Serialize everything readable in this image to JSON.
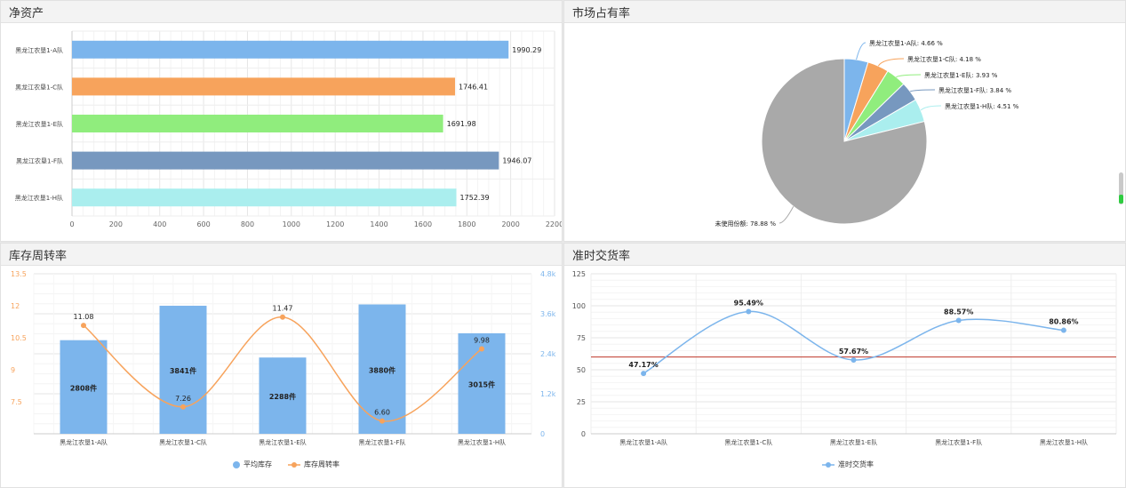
{
  "panels": {
    "net_assets": "净资产",
    "market_share": "市场占有率",
    "inventory_turnover": "库存周转率",
    "on_time_delivery": "准时交货率"
  },
  "chart_data": [
    {
      "type": "bar",
      "title": "净资产",
      "orientation": "horizontal",
      "categories": [
        "黑龙江农垦1-A队",
        "黑龙江农垦1-C队",
        "黑龙江农垦1-E队",
        "黑龙江农垦1-F队",
        "黑龙江农垦1-H队"
      ],
      "values": [
        1990.29,
        1746.41,
        1691.98,
        1946.07,
        1752.39
      ],
      "value_labels": [
        "1990.29",
        "1746.41",
        "1691.98",
        "1946.07",
        "1752.39"
      ],
      "colors": [
        "#7cb5ec",
        "#f7a35c",
        "#90ed7d",
        "#7798bf",
        "#aaeeee"
      ],
      "xlim": [
        0,
        2200
      ],
      "xticks": [
        0,
        200,
        400,
        600,
        800,
        1000,
        1200,
        1400,
        1600,
        1800,
        2000,
        2200
      ],
      "grid": true
    },
    {
      "type": "pie",
      "title": "市场占有率",
      "labels": [
        "黑龙江农垦1-A队",
        "黑龙江农垦1-C队",
        "黑龙江农垦1-E队",
        "黑龙江农垦1-F队",
        "黑龙江农垦1-H队",
        "未使用份额"
      ],
      "values": [
        4.66,
        4.18,
        3.93,
        3.84,
        4.51,
        78.88
      ],
      "label_texts": [
        "黑龙江农垦1-A队: 4.66 %",
        "黑龙江农垦1-C队: 4.18 %",
        "黑龙江农垦1-E队: 3.93 %",
        "黑龙江农垦1-F队: 3.84 %",
        "黑龙江农垦1-H队: 4.51 %",
        "未使用份额: 78.88 %"
      ],
      "colors": [
        "#7cb5ec",
        "#f7a35c",
        "#90ed7d",
        "#7798bf",
        "#aaeeee",
        "#a9a9a9"
      ]
    },
    {
      "type": "bar",
      "title": "库存周转率",
      "categories": [
        "黑龙江农垦1-A队",
        "黑龙江农垦1-C队",
        "黑龙江农垦1-E队",
        "黑龙江农垦1-F队",
        "黑龙江农垦1-H队"
      ],
      "series": [
        {
          "name": "平均库存",
          "type": "bar",
          "axis": "right",
          "values": [
            2808,
            3841,
            2288,
            3880,
            3015
          ],
          "value_labels": [
            "2808件",
            "3841件",
            "2288件",
            "3880件",
            "3015件"
          ],
          "color": "#7cb5ec"
        },
        {
          "name": "库存周转率",
          "type": "line",
          "axis": "left",
          "values": [
            11.08,
            7.26,
            11.47,
            6.6,
            9.98
          ],
          "value_labels": [
            "11.08",
            "7.26",
            "11.47",
            "6.60",
            "9.98"
          ],
          "color": "#f7a35c"
        }
      ],
      "yleft_ticks": [
        "7.5",
        "9",
        "10.5",
        "12",
        "13.5"
      ],
      "yleft_range": [
        6,
        13.5
      ],
      "yright_ticks": [
        "0",
        "1.2k",
        "2.4k",
        "3.6k",
        "4.8k"
      ],
      "yright_range": [
        0,
        4800
      ],
      "legend": "bottom-center",
      "grid": true
    },
    {
      "type": "line",
      "title": "准时交货率",
      "categories": [
        "黑龙江农垦1-A队",
        "黑龙江农垦1-C队",
        "黑龙江农垦1-E队",
        "黑龙江农垦1-F队",
        "黑龙江农垦1-H队"
      ],
      "series": [
        {
          "name": "准时交货率",
          "values": [
            47.17,
            95.49,
            57.67,
            88.57,
            80.86
          ],
          "value_labels": [
            "47.17%",
            "95.49%",
            "57.67%",
            "88.57%",
            "80.86%"
          ],
          "color": "#7cb5ec"
        }
      ],
      "reference_line": {
        "value": 60,
        "color": "#c0392b"
      },
      "ylim": [
        0,
        125
      ],
      "yticks": [
        0,
        25,
        50,
        75,
        100,
        125
      ],
      "legend": "bottom-center",
      "grid": true
    }
  ]
}
